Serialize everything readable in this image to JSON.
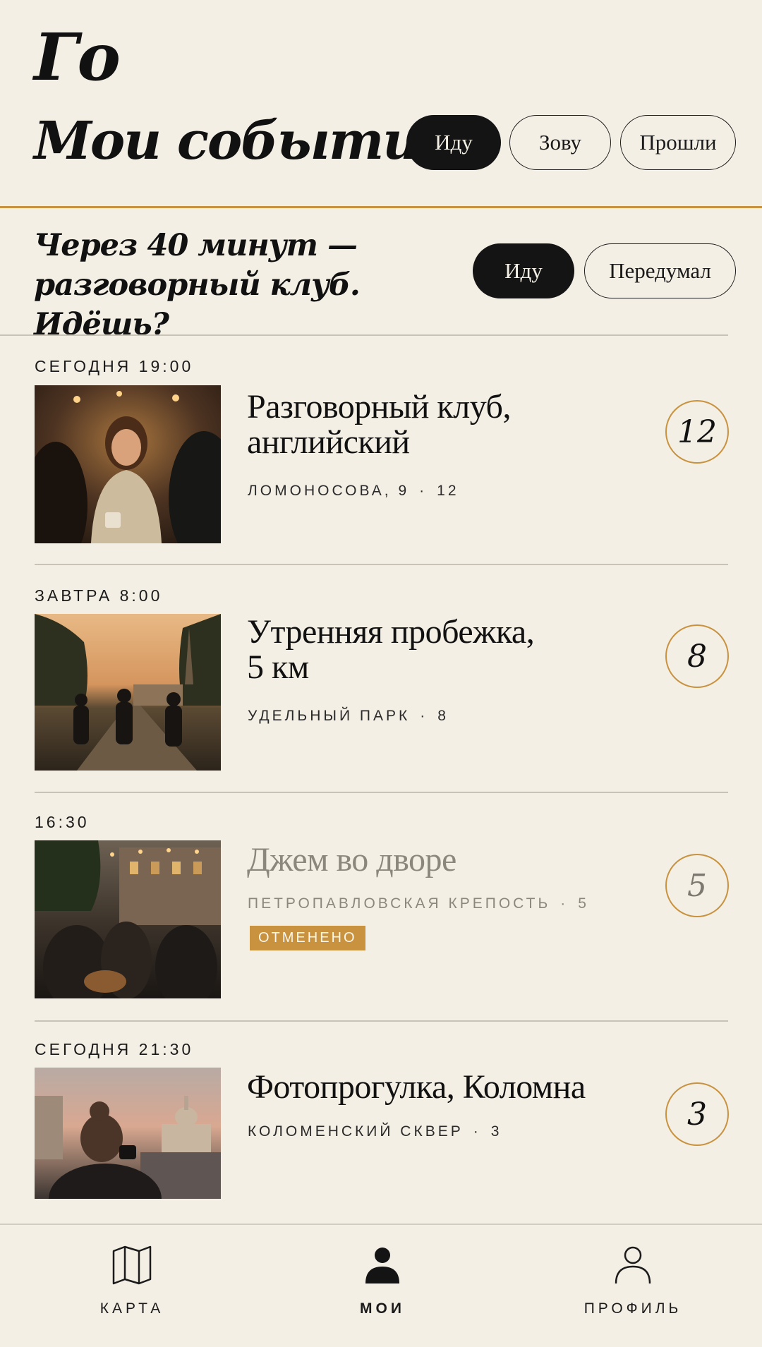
{
  "app": {
    "name": "Го"
  },
  "header": {
    "title": "Мои события",
    "tabs": [
      {
        "label": "Иду",
        "active": true
      },
      {
        "label": "Зову",
        "active": false
      },
      {
        "label": "Прошли",
        "active": false
      }
    ]
  },
  "reminder": {
    "text_line1": "Через 40 минут —",
    "text_line2": "разговорный клуб. Идёшь?",
    "accept_label": "Иду",
    "decline_label": "Передумал"
  },
  "events": [
    {
      "time": "СЕГОДНЯ 19:00",
      "title_line1": "Разговорный клуб,",
      "title_line2": "английский",
      "place": "ЛОМОНОСОВА, 9",
      "count": "12",
      "cancelled": false,
      "photo": "cafe-conversation-photo"
    },
    {
      "time": "ЗАВТРА 8:00",
      "title_line1": "Утренняя пробежка,",
      "title_line2": "5 км",
      "place": "УДЕЛЬНЫЙ ПАРК",
      "count": "8",
      "cancelled": false,
      "photo": "morning-run-photo"
    },
    {
      "time": "16:30",
      "title_line1": "Джем во дворе",
      "title_line2": "",
      "place": "ПЕТРОПАВЛОВСКАЯ КРЕПОСТЬ",
      "count": "5",
      "cancelled": true,
      "badge": "ОТМЕНЕНО",
      "photo": "courtyard-jam-photo"
    },
    {
      "time": "СЕГОДНЯ 21:30",
      "title_line1": "Фотопрогулка, Коломна",
      "title_line2": "",
      "place": "КОЛОМЕНСКИЙ СКВЕР",
      "count": "3",
      "cancelled": false,
      "photo": "photo-walk-photo"
    }
  ],
  "nav": {
    "items": [
      {
        "label": "КАРТА",
        "icon": "map-icon",
        "active": false
      },
      {
        "label": "МОИ",
        "icon": "person-filled-icon",
        "active": true
      },
      {
        "label": "ПРОФИЛЬ",
        "icon": "person-outline-icon",
        "active": false
      }
    ]
  },
  "colors": {
    "background": "#f4efe5",
    "accent": "#c8923f",
    "ink": "#141414"
  }
}
